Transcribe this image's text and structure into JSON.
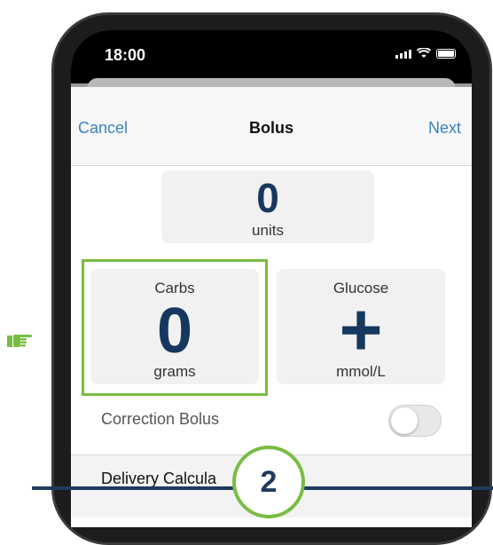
{
  "status_bar": {
    "time": "18:00"
  },
  "nav": {
    "cancel": "Cancel",
    "title": "Bolus",
    "next": "Next"
  },
  "units": {
    "value": "0",
    "label": "units"
  },
  "carbs": {
    "label": "Carbs",
    "value": "0",
    "unit": "grams"
  },
  "glucose": {
    "label": "Glucose",
    "value": "+",
    "unit": "mmol/L"
  },
  "correction": {
    "label": "Correction Bolus",
    "enabled": false
  },
  "delivery": {
    "label": "Delivery Calcula"
  },
  "step": {
    "number": "2"
  },
  "colors": {
    "accent_green": "#79bc43",
    "navy": "#16385f",
    "link_blue": "#3b82c4"
  },
  "icons": {
    "pointer": "pointing-hand-icon"
  }
}
